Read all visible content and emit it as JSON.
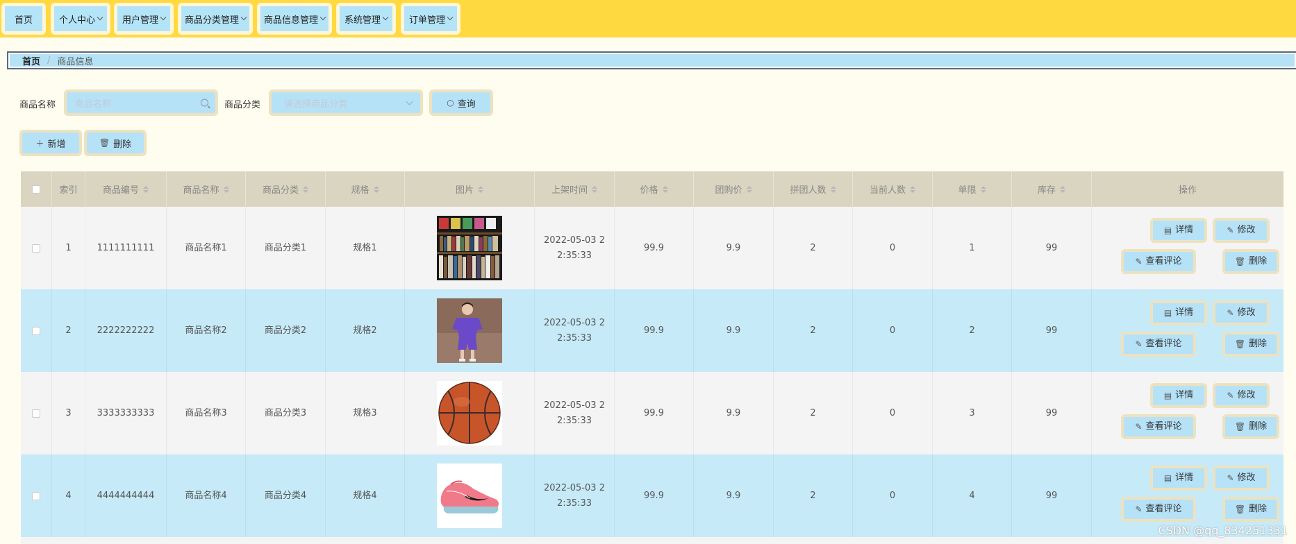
{
  "nav": [
    {
      "label": "首页",
      "dropdown": false
    },
    {
      "label": "个人中心",
      "dropdown": true
    },
    {
      "label": "用户管理",
      "dropdown": true
    },
    {
      "label": "商品分类管理",
      "dropdown": true
    },
    {
      "label": "商品信息管理",
      "dropdown": true
    },
    {
      "label": "系统管理",
      "dropdown": true
    },
    {
      "label": "订单管理",
      "dropdown": true
    }
  ],
  "breadcrumb": {
    "home": "首页",
    "separator": "/",
    "current": "商品信息"
  },
  "search": {
    "name_label": "商品名称",
    "name_placeholder": "商品名称",
    "category_label": "商品分类",
    "category_placeholder": "请选择商品分类",
    "query_button": "查询"
  },
  "actions": {
    "add": "新增",
    "delete": "删除"
  },
  "table": {
    "headers": [
      "索引",
      "商品编号",
      "商品名称",
      "商品分类",
      "规格",
      "图片",
      "上架时间",
      "价格",
      "团购价",
      "拼团人数",
      "当前人数",
      "单限",
      "库存",
      "操作"
    ],
    "rows": [
      {
        "index": "1",
        "code": "1111111111",
        "name": "商品名称1",
        "category": "商品分类1",
        "spec": "规格1",
        "image": "bookshelf-image",
        "time": "2022-05-03 22:35:33",
        "price": "99.9",
        "group_price": "9.9",
        "group_size": "2",
        "current": "0",
        "limit": "1",
        "stock": "99"
      },
      {
        "index": "2",
        "code": "2222222222",
        "name": "商品名称2",
        "category": "商品分类2",
        "spec": "规格2",
        "image": "purple-outfit-image",
        "time": "2022-05-03 22:35:33",
        "price": "99.9",
        "group_price": "9.9",
        "group_size": "2",
        "current": "0",
        "limit": "2",
        "stock": "99"
      },
      {
        "index": "3",
        "code": "3333333333",
        "name": "商品名称3",
        "category": "商品分类3",
        "spec": "规格3",
        "image": "basketball-image",
        "time": "2022-05-03 22:35:33",
        "price": "99.9",
        "group_price": "9.9",
        "group_size": "2",
        "current": "0",
        "limit": "3",
        "stock": "99"
      },
      {
        "index": "4",
        "code": "4444444444",
        "name": "商品名称4",
        "category": "商品分类4",
        "spec": "规格4",
        "image": "sneaker-image",
        "time": "2022-05-03 22:35:33",
        "price": "99.9",
        "group_price": "9.9",
        "group_size": "2",
        "current": "0",
        "limit": "4",
        "stock": "99"
      }
    ],
    "row_ops": {
      "detail": "详情",
      "edit": "修改",
      "comments": "查看评论",
      "delete": "删除"
    }
  },
  "watermark": "CSDN @qq_834251331",
  "colors": {
    "topbar": "#ffd93f",
    "button_fill": "#b6e2f8",
    "button_frame": "#ede2c0",
    "header": "#d9d5c0",
    "row_alt": "#c6eaf8"
  }
}
